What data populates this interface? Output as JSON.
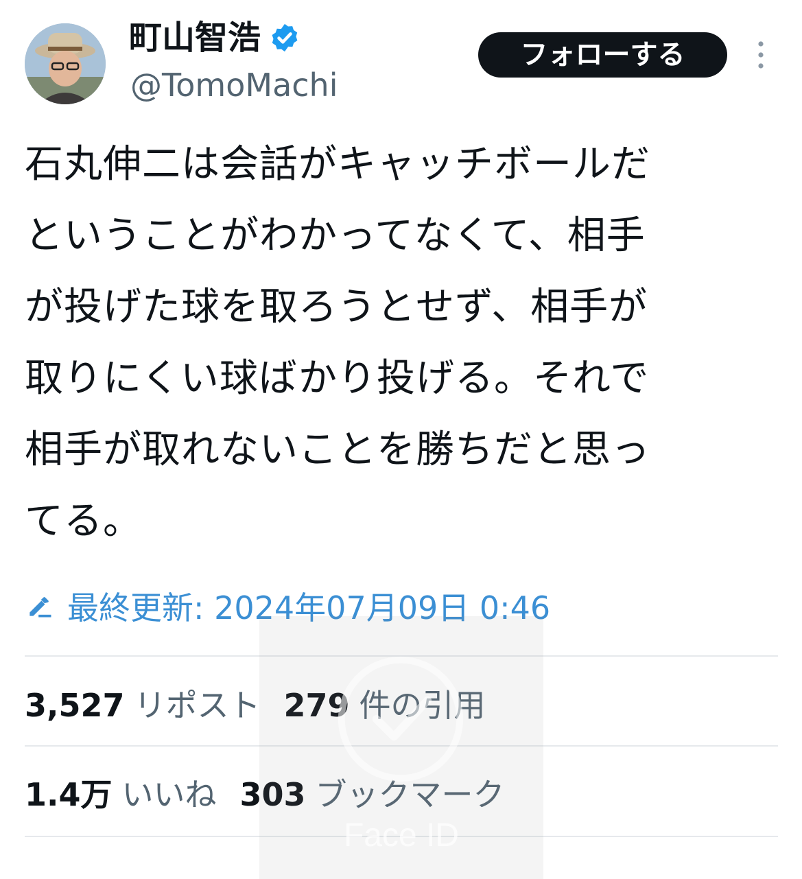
{
  "account": {
    "display_name": "町山智浩",
    "handle": "@TomoMachi",
    "avatar_icon": "profile-avatar",
    "verified_icon": "verified-badge-icon"
  },
  "actions": {
    "follow_label": "フォローする",
    "more_icon": "more-vertical-icon"
  },
  "post": {
    "text": "石丸伸二は会話がキャッチボールだ\nということがわかってなくて、相手\nが投げた球を取ろうとせず、相手が\n取りにくい球ばかり投げる。それで\n相手が取れないことを勝ちだと思っ\nてる。"
  },
  "edited": {
    "icon": "pencil-icon",
    "text": "最終更新: 2024年07月09日 0:46"
  },
  "stats": {
    "reposts": {
      "value": "3,527",
      "label": "リポスト"
    },
    "quotes": {
      "value": "279",
      "label": "件の引用"
    },
    "likes": {
      "value": "1.4万",
      "label": "いいね"
    },
    "bookmarks": {
      "value": "303",
      "label": "ブックマーク"
    }
  },
  "overlay": {
    "label": "Face ID",
    "icon": "face-id-icon"
  },
  "colors": {
    "text": "#0f1419",
    "secondary": "#536471",
    "accent": "#3b8fd4",
    "verified": "#1d9bf0",
    "follow_bg": "#0f1419"
  }
}
